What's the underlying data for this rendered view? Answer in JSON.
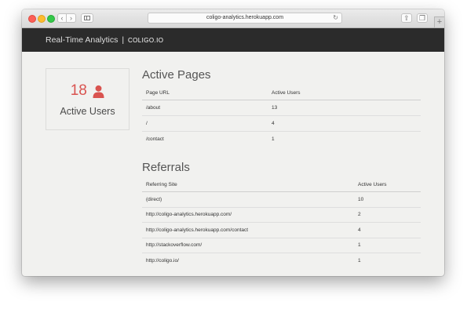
{
  "browser": {
    "url": "coligo-analytics.herokuapp.com",
    "back_glyph": "‹",
    "forward_glyph": "›",
    "reload_glyph": "↻",
    "share_glyph": "⇪",
    "tabs_glyph": "❐",
    "newtab_glyph": "+"
  },
  "navbar": {
    "title": "Real-Time Analytics",
    "separator": "|",
    "logo": "COLIGO.IO"
  },
  "stats": {
    "active_users_count": "18",
    "active_users_label": "Active Users",
    "icon": "user-icon",
    "accent_color": "#d9534f"
  },
  "active_pages": {
    "title": "Active Pages",
    "headers": [
      "Page URL",
      "Active Users"
    ],
    "rows": [
      [
        "/about",
        "13"
      ],
      [
        "/",
        "4"
      ],
      [
        "/contact",
        "1"
      ]
    ]
  },
  "referrals": {
    "title": "Referrals",
    "headers": [
      "Referring Site",
      "Active Users"
    ],
    "rows": [
      [
        "(direct)",
        "10"
      ],
      [
        "http://coligo-analytics.herokuapp.com/",
        "2"
      ],
      [
        "http://coligo-analytics.herokuapp.com/contact",
        "4"
      ],
      [
        "http://stackoverflow.com/",
        "1"
      ],
      [
        "http://coligo.io/",
        "1"
      ]
    ]
  },
  "colors": {
    "navbar_bg": "#2b2b2b",
    "page_bg": "#f1f1ef"
  }
}
